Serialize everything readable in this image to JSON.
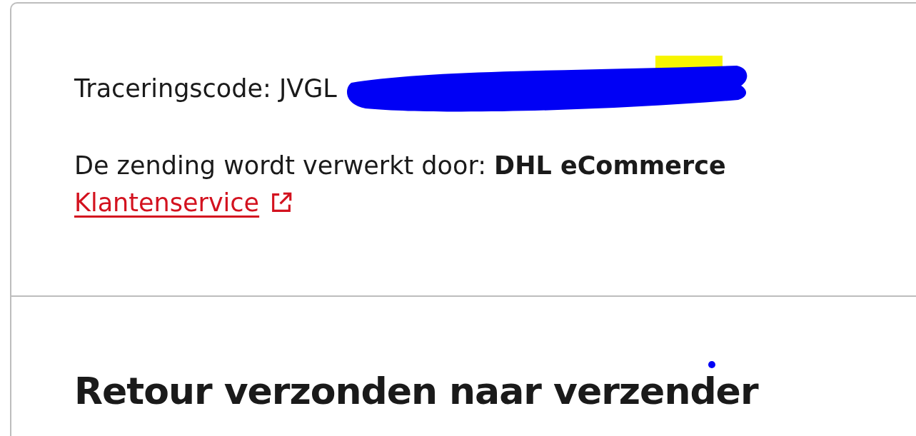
{
  "tracking": {
    "text": "Traceringscode: JVGL"
  },
  "handler": {
    "text": "De zending wordt verwerkt door: **DHL eCommerce**"
  },
  "support_link": {
    "label": "Klantenservice"
  },
  "section_heading": "Retour verzonden naar verzender"
}
